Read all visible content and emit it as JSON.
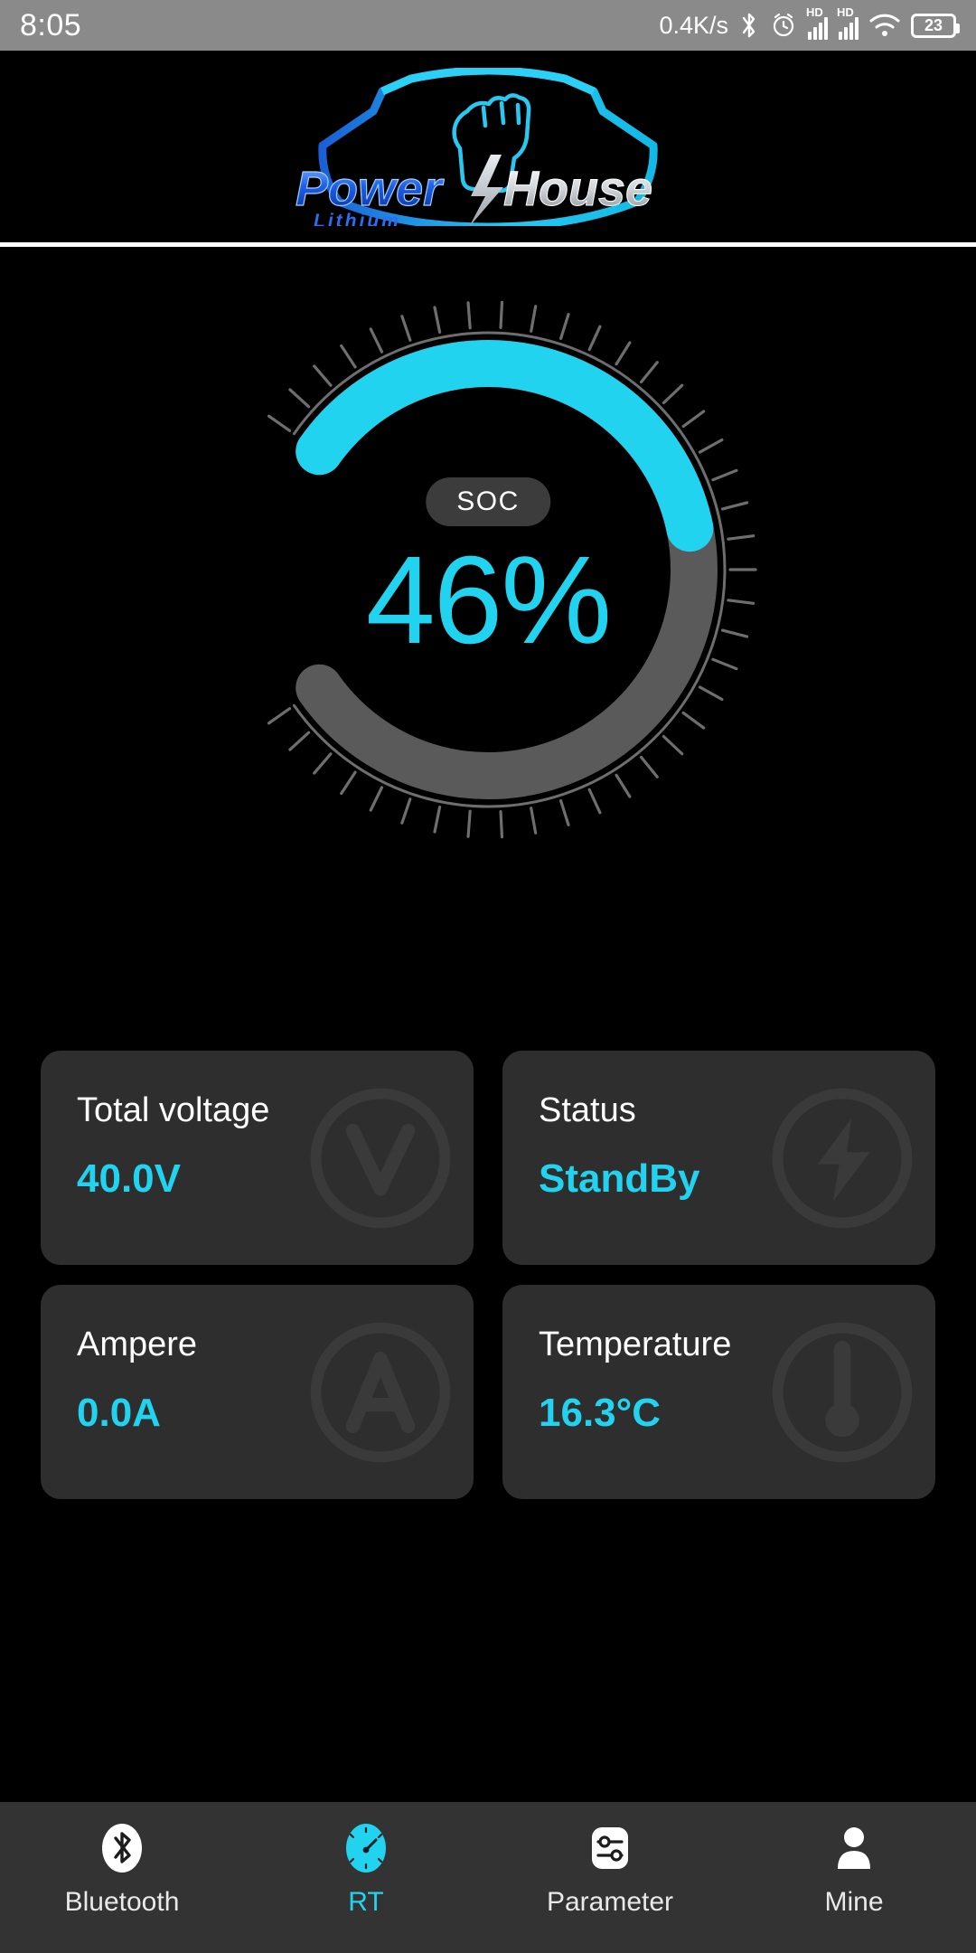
{
  "statusbar": {
    "time": "8:05",
    "network_speed": "0.4K/s",
    "bluetooth_icon": "bluetooth-icon",
    "alarm_icon": "alarm-icon",
    "sim1_label": "HD",
    "sim2_label": "HD",
    "wifi_icon": "wifi-icon",
    "battery_level": "23"
  },
  "header": {
    "brand_primary": "Power",
    "brand_secondary": "House",
    "brand_sub": "Lithium",
    "logo_icon": "powerhouse-shield-fist-logo"
  },
  "gauge": {
    "label": "SOC",
    "value_text": "46%",
    "accent_color": "#22d3f0",
    "track_color": "#5a5a5a",
    "tick_color": "#6e6e6e"
  },
  "chart_data": {
    "type": "gauge",
    "title": "SOC",
    "value": 46,
    "unit": "%",
    "range": [
      0,
      100
    ],
    "arc_start_deg": 215,
    "arc_sweep_deg": 290,
    "tick_count": 41,
    "progress_color": "#22d3f0",
    "track_color": "#5a5a5a"
  },
  "cards": [
    {
      "label": "Total voltage",
      "value": "40.0V",
      "watermark": "voltage-v-icon"
    },
    {
      "label": "Status",
      "value": "StandBy",
      "watermark": "lightning-bolt-icon"
    },
    {
      "label": "Ampere",
      "value": "0.0A",
      "watermark": "ampere-a-icon"
    },
    {
      "label": "Temperature",
      "value": "16.3°C",
      "watermark": "thermometer-icon"
    }
  ],
  "navbar": {
    "items": [
      {
        "label": "Bluetooth",
        "icon": "bluetooth-icon",
        "active": false
      },
      {
        "label": "RT",
        "icon": "gauge-icon",
        "active": true
      },
      {
        "label": "Parameter",
        "icon": "sliders-icon",
        "active": false
      },
      {
        "label": "Mine",
        "icon": "person-icon",
        "active": false
      }
    ]
  }
}
